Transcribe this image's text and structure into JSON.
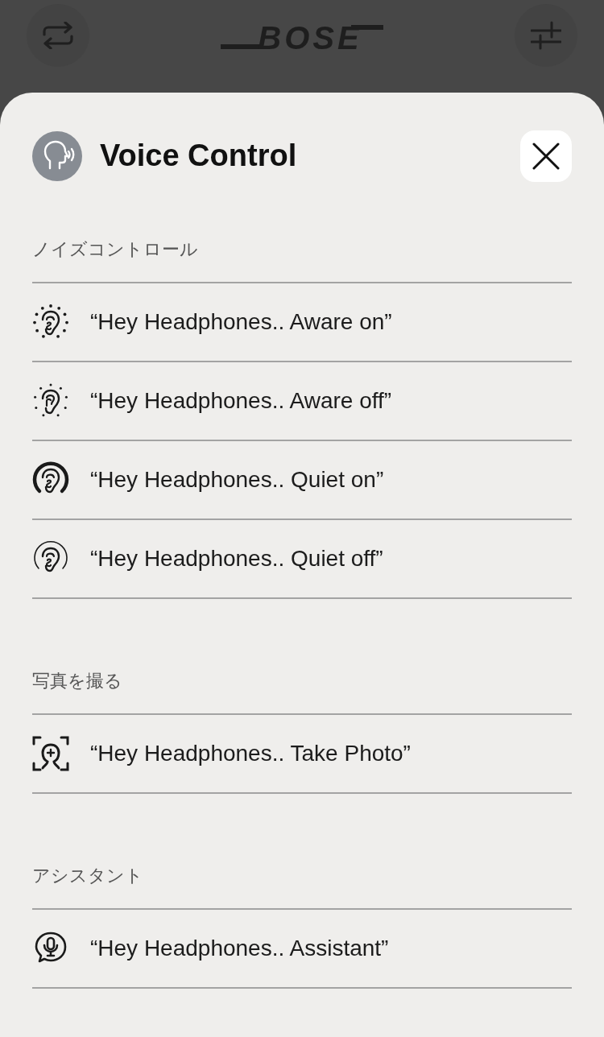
{
  "top_bar": {
    "logo": "BOSE"
  },
  "panel": {
    "title": "Voice Control"
  },
  "sections": [
    {
      "heading": "ノイズコントロール",
      "commands": [
        {
          "kind": "aware-on",
          "text": "“Hey Headphones.. Aware on”"
        },
        {
          "kind": "aware-off",
          "text": "“Hey Headphones.. Aware off”"
        },
        {
          "kind": "quiet-on",
          "text": "“Hey Headphones.. Quiet on”"
        },
        {
          "kind": "quiet-off",
          "text": "“Hey Headphones.. Quiet off”"
        }
      ]
    },
    {
      "heading": "写真を撮る",
      "commands": [
        {
          "kind": "photo",
          "text": "“Hey Headphones.. Take Photo”"
        }
      ]
    },
    {
      "heading": "アシスタント",
      "commands": [
        {
          "kind": "assistant",
          "text": "“Hey Headphones.. Assistant”"
        }
      ]
    }
  ]
}
